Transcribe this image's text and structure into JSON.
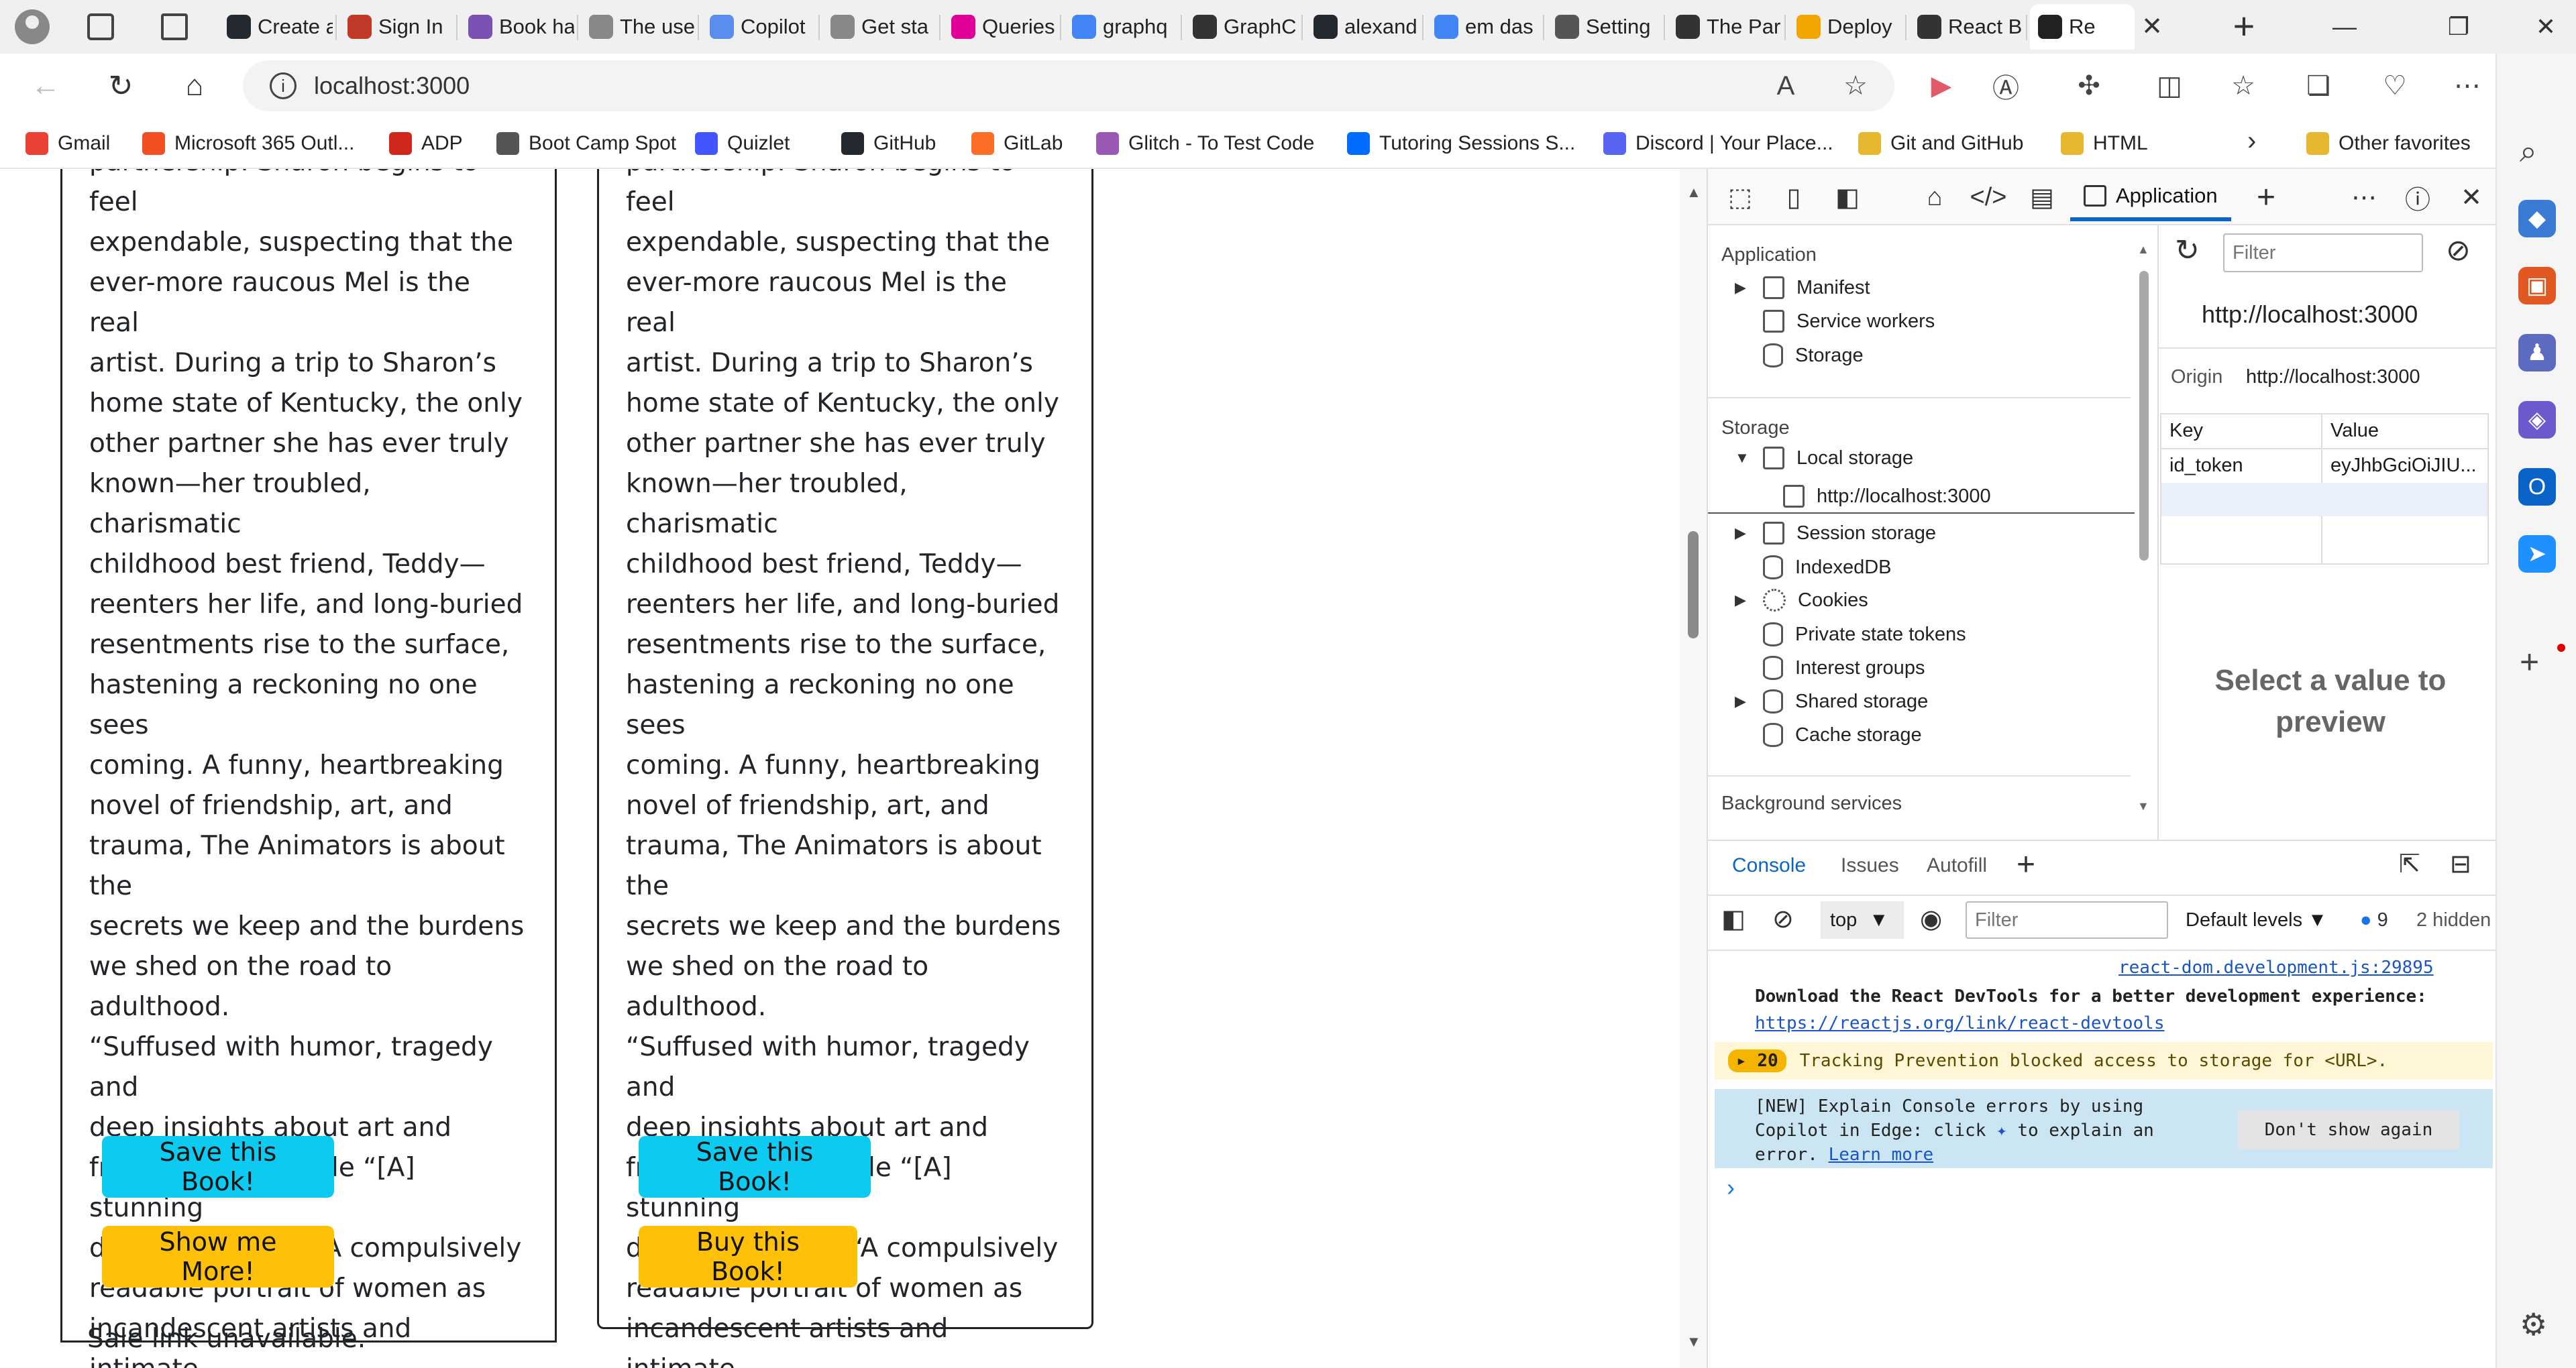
{
  "tabs": [
    {
      "label": "Create a",
      "icon": "github-icon",
      "color": "#24292f"
    },
    {
      "label": "Sign In",
      "icon": "shield-icon",
      "color": "#c0392b"
    },
    {
      "label": "Book ha",
      "icon": "bootstrap-icon",
      "color": "#7952b3"
    },
    {
      "label": "The use",
      "icon": "a-circle-icon",
      "color": "#888888"
    },
    {
      "label": "Copilot",
      "icon": "copilot-icon",
      "color": "#5b8def"
    },
    {
      "label": "Get sta",
      "icon": "a-circle-icon",
      "color": "#888888"
    },
    {
      "label": "Queries",
      "icon": "graphql-icon",
      "color": "#e10098"
    },
    {
      "label": "graphq",
      "icon": "google-icon",
      "color": "#4285f4"
    },
    {
      "label": "GraphC",
      "icon": "video-icon",
      "color": "#333333"
    },
    {
      "label": "alexand",
      "icon": "github-icon",
      "color": "#24292f"
    },
    {
      "label": "em das",
      "icon": "google-icon",
      "color": "#4285f4"
    },
    {
      "label": "Setting",
      "icon": "gear-icon",
      "color": "#555555"
    },
    {
      "label": "The Par",
      "icon": "the-paragon-icon",
      "color": "#333333"
    },
    {
      "label": "Deploy",
      "icon": "fs-icon",
      "color": "#f0a500"
    },
    {
      "label": "React B",
      "icon": "openai-icon",
      "color": "#333333"
    },
    {
      "label": "Re",
      "icon": "book-icon",
      "color": "#222222"
    }
  ],
  "address": {
    "url": "localhost:3000"
  },
  "bookmarks": [
    {
      "label": "Gmail",
      "icon": "gmail-icon",
      "color": "#ea4335"
    },
    {
      "label": "Microsoft 365 Outl...",
      "icon": "microsoft-icon",
      "color": "#f25022"
    },
    {
      "label": "ADP",
      "icon": "adp-icon",
      "color": "#d0271d"
    },
    {
      "label": "Boot Camp Spot",
      "icon": "page-icon",
      "color": "#555555"
    },
    {
      "label": "Quizlet",
      "icon": "quizlet-icon",
      "color": "#4255ff"
    },
    {
      "label": "GitHub",
      "icon": "github-icon",
      "color": "#24292f"
    },
    {
      "label": "GitLab",
      "icon": "gitlab-icon",
      "color": "#fc6d26"
    },
    {
      "label": "Glitch - To Test Code",
      "icon": "glitch-icon",
      "color": "#9b59b6"
    },
    {
      "label": "Tutoring Sessions S...",
      "icon": "calendly-icon",
      "color": "#006bff"
    },
    {
      "label": "Discord | Your Place...",
      "icon": "discord-icon",
      "color": "#5865f2"
    },
    {
      "label": "Git and GitHub",
      "icon": "folder-icon",
      "color": "#e8b730"
    },
    {
      "label": "HTML",
      "icon": "folder-icon",
      "color": "#e8b730"
    },
    {
      "label": "Other favorites",
      "icon": "folder-icon",
      "color": "#e8b730"
    }
  ],
  "books": [
    {
      "description": "partnership. Sharon begins to feel\nexpendable, suspecting that the\never-more raucous Mel is the real\nartist. During a trip to Sharon’s\nhome state of Kentucky, the only\nother partner she has ever truly\nknown—her troubled, charismatic\nchildhood best friend, Teddy—\nreenters her life, and long-buried\nresentments rise to the surface,\nhastening a reckoning no one sees\ncoming. A funny, heartbreaking\nnovel of friendship, art, and\ntrauma, The Animators is about the\nsecrets we keep and the burdens\nwe shed on the road to adulthood.\n“Suffused with humor, tragedy and\ndeep insights about art and\nfriendship.”—People “[A] stunning\ndebut.”—Variety “A compulsively\nreadable portrait of women as\nincandescent artists and intimate\ncollaborators.”—Elle",
      "save_label": "Save this Book!",
      "secondary_label": "Show me More!",
      "sale_text": "Sale link unavailable."
    },
    {
      "description": "partnership. Sharon begins to feel\nexpendable, suspecting that the\never-more raucous Mel is the real\nartist. During a trip to Sharon’s\nhome state of Kentucky, the only\nother partner she has ever truly\nknown—her troubled, charismatic\nchildhood best friend, Teddy—\nreenters her life, and long-buried\nresentments rise to the surface,\nhastening a reckoning no one sees\ncoming. A funny, heartbreaking\nnovel of friendship, art, and\ntrauma, The Animators is about the\nsecrets we keep and the burdens\nwe shed on the road to adulthood.\n“Suffused with humor, tragedy and\ndeep insights about art and\nfriendship.”—People “[A] stunning\ndebut.”—Variety “A compulsively\nreadable portrait of women as\nincandescent artists and intimate\ncollaborators.”—Elle",
      "save_label": "Save this Book!",
      "secondary_label": "Buy this Book!"
    }
  ],
  "devtools": {
    "active_tab": "Application",
    "application_heading": "Application",
    "application_items": [
      "Manifest",
      "Service workers",
      "Storage"
    ],
    "storage_heading": "Storage",
    "local_storage": "Local storage",
    "local_storage_origin": "http://localhost:3000",
    "storage_items": [
      "Session storage",
      "IndexedDB",
      "Cookies",
      "Private state tokens",
      "Interest groups",
      "Shared storage",
      "Cache storage"
    ],
    "background_heading": "Background services",
    "filter_placeholder": "Filter",
    "origin_title": "http://localhost:3000",
    "origin_label": "Origin",
    "origin_value": "http://localhost:3000",
    "table_headers": [
      "Key",
      "Value"
    ],
    "table_rows": [
      {
        "key": "id_token",
        "value": "eyJhbGciOiJIU..."
      }
    ],
    "preview_text": "Select a value to preview",
    "console": {
      "tabs": [
        "Console",
        "Issues",
        "Autofill"
      ],
      "context": "top",
      "filter_placeholder": "Filter",
      "levels": "Default levels",
      "issues_count": "9",
      "hidden": "2 hidden",
      "source_link": "react-dom.development.js:29895",
      "devtools_msg": "Download the React DevTools for a better development experience: ",
      "devtools_link": "https://reactjs.org/link/react-devtools",
      "warning_count": "20",
      "warning_msg": "Tracking Prevention blocked access to storage for <URL>.",
      "copilot_msg": "[NEW] Explain Console errors by using Copilot in Edge: click",
      "copilot_msg2": "to explain an error.",
      "learn_more": "Learn more",
      "dont_show": "Don't show again"
    }
  }
}
